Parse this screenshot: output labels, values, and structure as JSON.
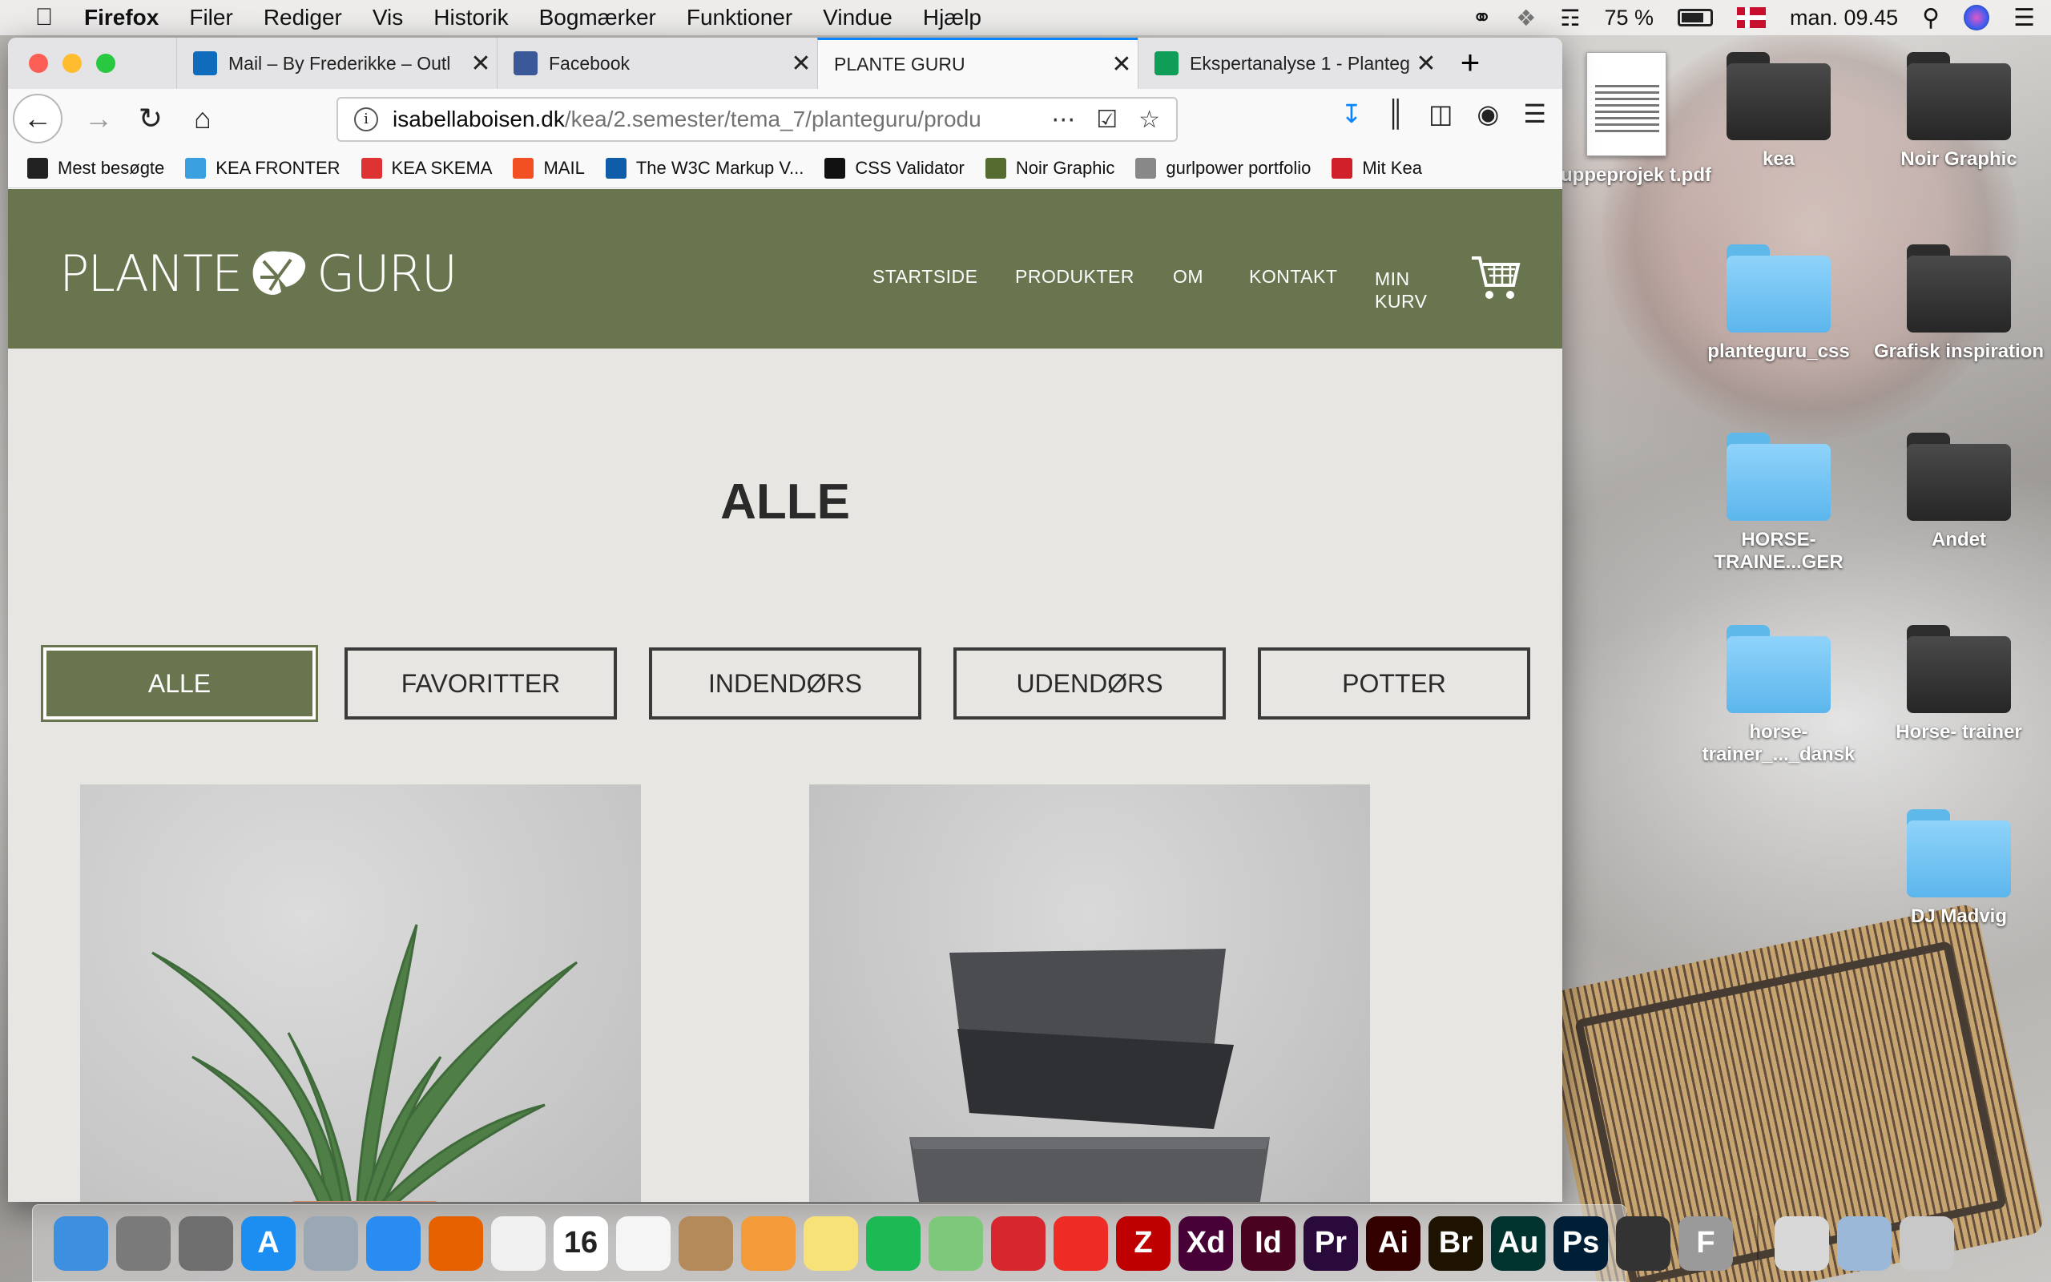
{
  "menubar": {
    "app": "Firefox",
    "items": [
      "Filer",
      "Rediger",
      "Vis",
      "Historik",
      "Bogmærker",
      "Funktioner",
      "Vindue",
      "Hjælp"
    ],
    "battery": "75 %",
    "clock": "man. 09.45"
  },
  "tabs": [
    {
      "label": "Mail – By Frederikke – Outl",
      "icon": "outlook-icon",
      "color": "#0f6cbd"
    },
    {
      "label": "Facebook",
      "icon": "facebook-icon",
      "color": "#3b5998"
    },
    {
      "label": "PLANTE GURU",
      "icon": "none",
      "color": "#f9f9fa"
    },
    {
      "label": "Ekspertanalyse 1 - Planteg",
      "icon": "sheets-icon",
      "color": "#0f9d58"
    }
  ],
  "urlbar": {
    "host": "isabellaboisen.dk",
    "path": "/kea/2.semester/tema_7/planteguru/produ"
  },
  "bookmarks": [
    {
      "label": "Mest besøgte",
      "icon": "gear-icon",
      "color": "#222"
    },
    {
      "label": "KEA FRONTER",
      "icon": "fronter-icon",
      "color": "#3aa0e0"
    },
    {
      "label": "KEA SKEMA",
      "icon": "skema-icon",
      "color": "#d33"
    },
    {
      "label": "MAIL",
      "icon": "microsoft-icon",
      "color": "#f25022"
    },
    {
      "label": "The W3C Markup V...",
      "icon": "w3c-icon",
      "color": "#0f5ca8"
    },
    {
      "label": "CSS Validator",
      "icon": "css-icon",
      "color": "#111"
    },
    {
      "label": "Noir Graphic",
      "icon": "noir-icon",
      "color": "#556b2f"
    },
    {
      "label": "gurlpower portfolio",
      "icon": "globe-icon",
      "color": "#888"
    },
    {
      "label": "Mit Kea",
      "icon": "kea-icon",
      "color": "#d0202a"
    }
  ],
  "site": {
    "logo_left": "PLANTE",
    "logo_right": "GURU",
    "nav": {
      "startside": "STARTSIDE",
      "produkter": "PRODUKTER",
      "om": "OM",
      "kontakt": "KONTAKT",
      "min": "MIN",
      "kurv": "KURV"
    },
    "title": "ALLE",
    "filters": [
      "ALLE",
      "FAVORITTER",
      "INDENDØRS",
      "UDENDØRS",
      "POTTER"
    ],
    "accent": "#68754e",
    "background": "#e8e6e3"
  },
  "desktop": {
    "icons": [
      {
        "label": "gruppeprojek t.pdf",
        "type": "pdf"
      },
      {
        "label": "kea",
        "type": "dark"
      },
      {
        "label": "Noir Graphic",
        "type": "dark"
      },
      {
        "label": "planteguru_css",
        "type": "blue"
      },
      {
        "label": "Grafisk inspiration",
        "type": "dark"
      },
      {
        "label": "HORSE- TRAINE...GER",
        "type": "blue"
      },
      {
        "label": "Andet",
        "type": "dark"
      },
      {
        "label": "horse- trainer_..._dansk",
        "type": "blue"
      },
      {
        "label": "Horse- trainer",
        "type": "dark"
      },
      {
        "label": "DJ Madvig",
        "type": "blue"
      }
    ]
  },
  "dock": [
    {
      "name": "finder-icon",
      "glyph": "",
      "color": "#3d8fe0"
    },
    {
      "name": "launchpad-icon",
      "glyph": "",
      "color": "#7a7a7a"
    },
    {
      "name": "system-preferences-icon",
      "glyph": "",
      "color": "#6e6e6e"
    },
    {
      "name": "app-store-icon",
      "glyph": "A",
      "color": "#1c8ef2"
    },
    {
      "name": "preview-bird-icon",
      "glyph": "",
      "color": "#9aa8b5"
    },
    {
      "name": "safari-icon",
      "glyph": "",
      "color": "#2a8cf0"
    },
    {
      "name": "firefox-icon",
      "glyph": "",
      "color": "#e66000"
    },
    {
      "name": "photos-icon",
      "glyph": "",
      "color": "#f0f0f0"
    },
    {
      "name": "calendar-icon",
      "glyph": "16",
      "color": "#ffffff"
    },
    {
      "name": "reminders-icon",
      "glyph": "",
      "color": "#f5f5f5"
    },
    {
      "name": "contacts-icon",
      "glyph": "",
      "color": "#b58a5a"
    },
    {
      "name": "pages-icon",
      "glyph": "",
      "color": "#f29b38"
    },
    {
      "name": "notes-icon",
      "glyph": "",
      "color": "#f7e27a"
    },
    {
      "name": "spotify-icon",
      "glyph": "",
      "color": "#1db954"
    },
    {
      "name": "maps-icon",
      "glyph": "",
      "color": "#7dc87a"
    },
    {
      "name": "creative-cloud-icon",
      "glyph": "",
      "color": "#d7262e"
    },
    {
      "name": "acrobat-icon",
      "glyph": "",
      "color": "#ee2b24"
    },
    {
      "name": "filezilla-icon",
      "glyph": "Z",
      "color": "#bf0000"
    },
    {
      "name": "xd-icon",
      "glyph": "Xd",
      "color": "#470137"
    },
    {
      "name": "indesign-icon",
      "glyph": "Id",
      "color": "#49021f"
    },
    {
      "name": "premiere-icon",
      "glyph": "Pr",
      "color": "#2a0a3a"
    },
    {
      "name": "illustrator-icon",
      "glyph": "Ai",
      "color": "#330000"
    },
    {
      "name": "bridge-icon",
      "glyph": "Br",
      "color": "#1e1300"
    },
    {
      "name": "audition-icon",
      "glyph": "Au",
      "color": "#00332e"
    },
    {
      "name": "photoshop-icon",
      "glyph": "Ps",
      "color": "#001e36"
    },
    {
      "name": "screen-icon",
      "glyph": "",
      "color": "#333"
    },
    {
      "name": "font-icon",
      "glyph": "F",
      "color": "#9a9a9a"
    },
    {
      "name": "texteditor-icon",
      "glyph": "",
      "color": "#d8d8d8"
    },
    {
      "name": "preview-icon",
      "glyph": "",
      "color": "#9bb8d8"
    },
    {
      "name": "trash-icon",
      "glyph": "",
      "color": "#c8c8c8"
    }
  ]
}
